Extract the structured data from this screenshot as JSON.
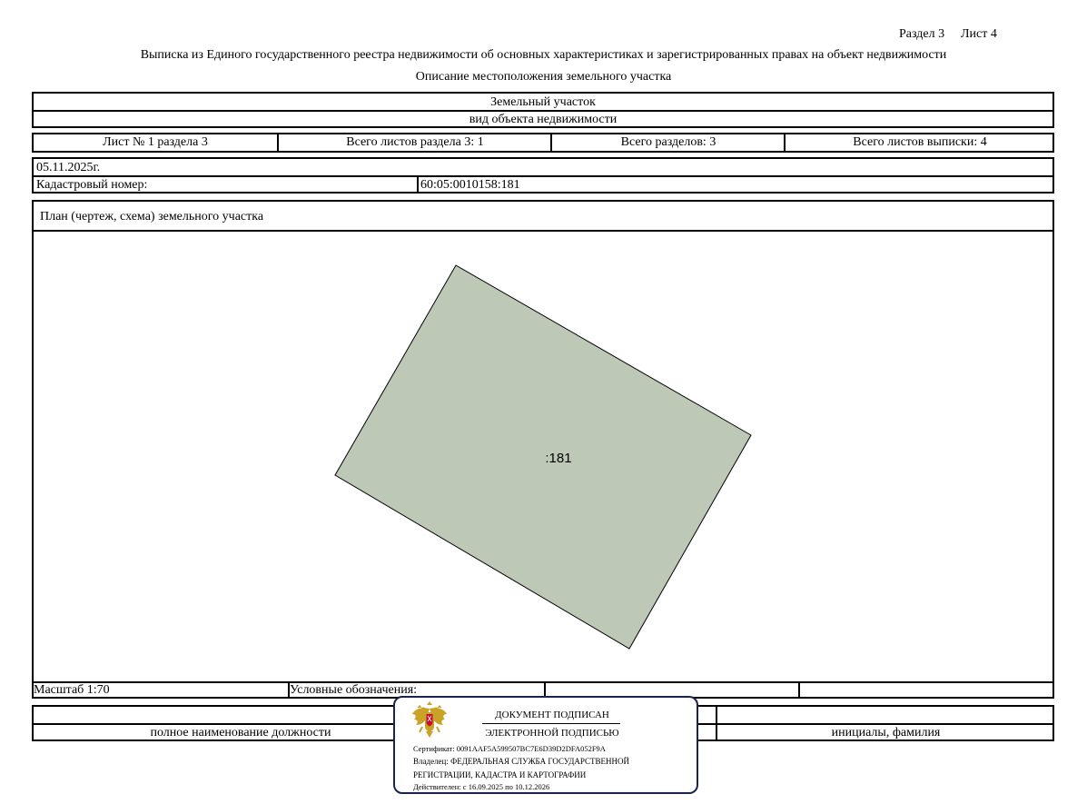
{
  "header": {
    "section": "Раздел 3",
    "sheet": "Лист 4",
    "title": "Выписка из Единого государственного реестра недвижимости об основных характеристиках и зарегистрированных правах на объект недвижимости",
    "subtitle": "Описание местоположения земельного участка"
  },
  "object": {
    "type": "Земельный участок",
    "type_caption": "вид объекта недвижимости"
  },
  "sheets": {
    "sheet_of_section": "Лист № 1 раздела 3",
    "total_sheets_section": "Всего листов раздела 3: 1",
    "total_sections": "Всего разделов: 3",
    "total_sheets_extract": "Всего листов выписки: 4"
  },
  "info": {
    "date": "05.11.2025г.",
    "cadastral_label": "Кадастровый номер:",
    "cadastral_number": "60:05:0010158:181"
  },
  "plan": {
    "title": "План (чертеж, схема) земельного участка",
    "parcel_label": ":181",
    "parcel_fill": "#bdc9b6",
    "scale": "Масштаб 1:70",
    "legend_label": "Условные обозначения:"
  },
  "footer": {
    "position_caption": "полное наименование должности",
    "name_caption": "инициалы, фамилия"
  },
  "signature": {
    "line1": "ДОКУМЕНТ ПОДПИСАН",
    "line2": "ЭЛЕКТРОННОЙ ПОДПИСЬЮ",
    "certificate": "Сертификат: 0091AAF5A599507BC7E6D39D2DFA052F9A",
    "owner_line1": "Владелец: ФЕДЕРАЛЬНАЯ СЛУЖБА ГОСУДАРСТВЕННОЙ",
    "owner_line2": "РЕГИСТРАЦИИ, КАДАСТРА И КАРТОГРАФИИ",
    "valid": "Действителен: с 16.09.2025 по 10.12.2026",
    "border_color": "#1a2250",
    "emblem_icon": "double-headed-eagle-icon"
  }
}
